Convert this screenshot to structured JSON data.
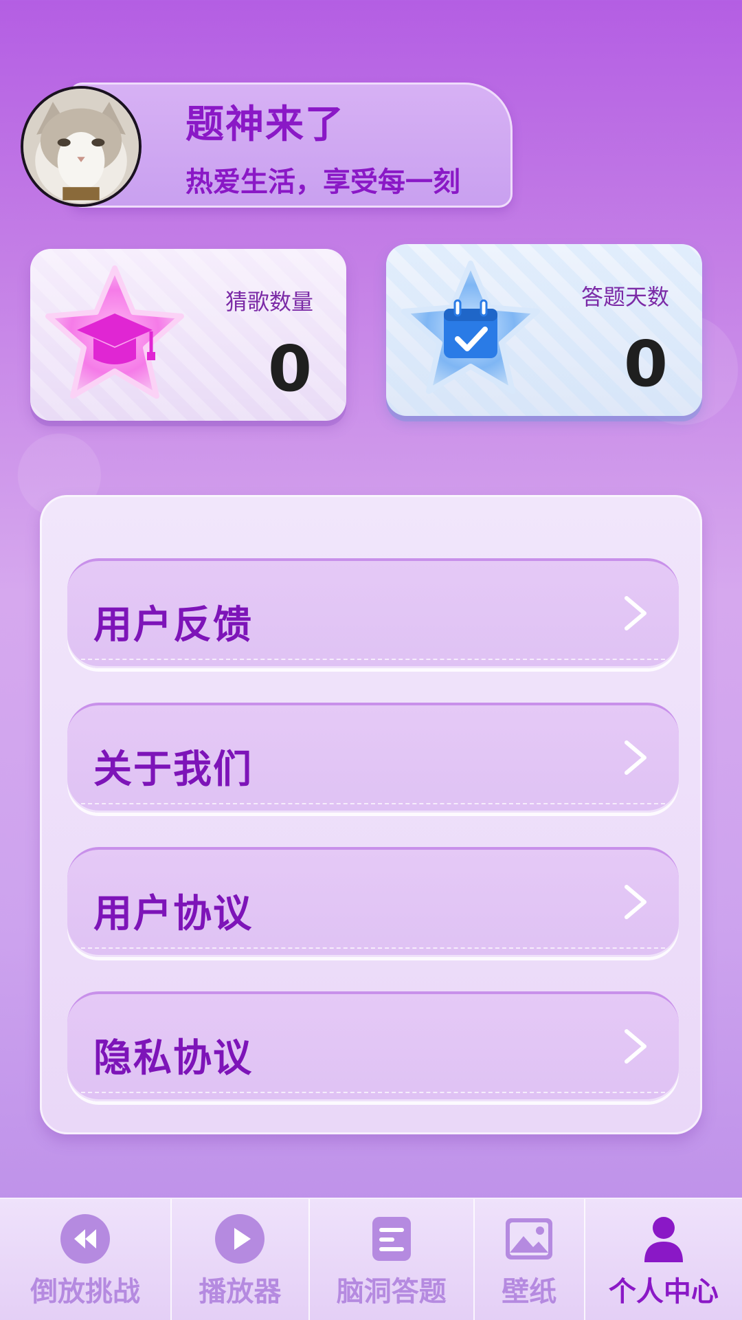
{
  "profile": {
    "name": "题神来了",
    "bio": "热爱生活，享受每一刻"
  },
  "stats": [
    {
      "label": "猜歌数量",
      "value": "0",
      "icon": "graduation-cap-icon",
      "color": "#e23ad6"
    },
    {
      "label": "答题天数",
      "value": "0",
      "icon": "calendar-check-icon",
      "color": "#2a7be6"
    }
  ],
  "menu": {
    "items": [
      {
        "label": "用户反馈",
        "icon": "chevron-right-icon"
      },
      {
        "label": "关于我们",
        "icon": "chevron-right-icon"
      },
      {
        "label": "用户协议",
        "icon": "chevron-right-icon"
      },
      {
        "label": "隐私协议",
        "icon": "chevron-right-icon"
      }
    ]
  },
  "nav": {
    "items": [
      {
        "label": "倒放挑战",
        "icon": "rewind-icon",
        "active": false
      },
      {
        "label": "播放器",
        "icon": "play-icon",
        "active": false
      },
      {
        "label": "脑洞答题",
        "icon": "quiz-icon",
        "active": false
      },
      {
        "label": "壁纸",
        "icon": "image-icon",
        "active": false
      },
      {
        "label": "个人中心",
        "icon": "user-icon",
        "active": true
      }
    ]
  },
  "colors": {
    "accent": "#8a18c6",
    "background_top": "#b45ee3",
    "nav_inactive": "#b58ae0"
  }
}
